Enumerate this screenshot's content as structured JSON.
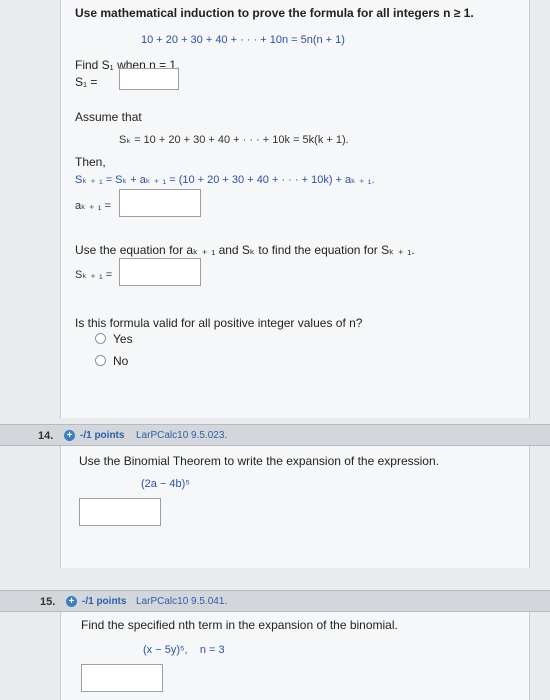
{
  "q13": {
    "instruction": "Use mathematical induction to prove the formula for all integers n ≥ 1.",
    "formula": "10 + 20 + 30 + 40 + · · · + 10n = 5n(n + 1)",
    "find_s1_label": "Find S₁ when n = 1.",
    "s1_label": "S₁ =",
    "assume_label": "Assume that",
    "assume_formula": "Sₖ = 10 + 20 + 30 + 40 + · · · + 10k = 5k(k + 1).",
    "then_label": "Then,",
    "then_formula": "Sₖ ₊ ₁ = Sₖ + aₖ ₊ ₁ = (10 + 20 + 30 + 40 + · · · + 10k) + aₖ ₊ ₁.",
    "ak1_label": "aₖ ₊ ₁ =",
    "use_eq_label": "Use the equation for aₖ ₊ ₁ and Sₖ to find the equation for Sₖ ₊ ₁.",
    "sk1_label": "Sₖ ₊ ₁ =",
    "valid_question": "Is this formula valid for all positive integer values of n?",
    "options": [
      "Yes",
      "No"
    ]
  },
  "q14": {
    "number": "14.",
    "points": "-/1 points",
    "book_ref": "LarPCalc10 9.5.023.",
    "instruction": "Use the Binomial Theorem to write the expansion of the expression.",
    "expression": "(2a − 4b)⁵"
  },
  "q15": {
    "number": "15.",
    "points": "-/1 points",
    "book_ref": "LarPCalc10 9.5.041.",
    "instruction": "Find the specified nth term in the expansion of the binomial.",
    "expression": "(x − 5y)⁵,    n = 3"
  },
  "colors": {
    "accent": "#2d5fa8",
    "header_bg": "#d3d6da",
    "panel_bg": "#f6f7f8"
  }
}
